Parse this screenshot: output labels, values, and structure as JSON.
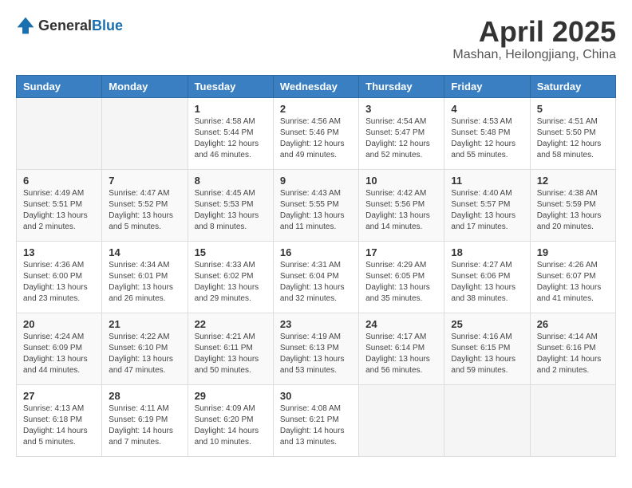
{
  "logo": {
    "general": "General",
    "blue": "Blue"
  },
  "header": {
    "month": "April 2025",
    "location": "Mashan, Heilongjiang, China"
  },
  "weekdays": [
    "Sunday",
    "Monday",
    "Tuesday",
    "Wednesday",
    "Thursday",
    "Friday",
    "Saturday"
  ],
  "weeks": [
    [
      {
        "day": "",
        "info": ""
      },
      {
        "day": "",
        "info": ""
      },
      {
        "day": "1",
        "info": "Sunrise: 4:58 AM\nSunset: 5:44 PM\nDaylight: 12 hours and 46 minutes."
      },
      {
        "day": "2",
        "info": "Sunrise: 4:56 AM\nSunset: 5:46 PM\nDaylight: 12 hours and 49 minutes."
      },
      {
        "day": "3",
        "info": "Sunrise: 4:54 AM\nSunset: 5:47 PM\nDaylight: 12 hours and 52 minutes."
      },
      {
        "day": "4",
        "info": "Sunrise: 4:53 AM\nSunset: 5:48 PM\nDaylight: 12 hours and 55 minutes."
      },
      {
        "day": "5",
        "info": "Sunrise: 4:51 AM\nSunset: 5:50 PM\nDaylight: 12 hours and 58 minutes."
      }
    ],
    [
      {
        "day": "6",
        "info": "Sunrise: 4:49 AM\nSunset: 5:51 PM\nDaylight: 13 hours and 2 minutes."
      },
      {
        "day": "7",
        "info": "Sunrise: 4:47 AM\nSunset: 5:52 PM\nDaylight: 13 hours and 5 minutes."
      },
      {
        "day": "8",
        "info": "Sunrise: 4:45 AM\nSunset: 5:53 PM\nDaylight: 13 hours and 8 minutes."
      },
      {
        "day": "9",
        "info": "Sunrise: 4:43 AM\nSunset: 5:55 PM\nDaylight: 13 hours and 11 minutes."
      },
      {
        "day": "10",
        "info": "Sunrise: 4:42 AM\nSunset: 5:56 PM\nDaylight: 13 hours and 14 minutes."
      },
      {
        "day": "11",
        "info": "Sunrise: 4:40 AM\nSunset: 5:57 PM\nDaylight: 13 hours and 17 minutes."
      },
      {
        "day": "12",
        "info": "Sunrise: 4:38 AM\nSunset: 5:59 PM\nDaylight: 13 hours and 20 minutes."
      }
    ],
    [
      {
        "day": "13",
        "info": "Sunrise: 4:36 AM\nSunset: 6:00 PM\nDaylight: 13 hours and 23 minutes."
      },
      {
        "day": "14",
        "info": "Sunrise: 4:34 AM\nSunset: 6:01 PM\nDaylight: 13 hours and 26 minutes."
      },
      {
        "day": "15",
        "info": "Sunrise: 4:33 AM\nSunset: 6:02 PM\nDaylight: 13 hours and 29 minutes."
      },
      {
        "day": "16",
        "info": "Sunrise: 4:31 AM\nSunset: 6:04 PM\nDaylight: 13 hours and 32 minutes."
      },
      {
        "day": "17",
        "info": "Sunrise: 4:29 AM\nSunset: 6:05 PM\nDaylight: 13 hours and 35 minutes."
      },
      {
        "day": "18",
        "info": "Sunrise: 4:27 AM\nSunset: 6:06 PM\nDaylight: 13 hours and 38 minutes."
      },
      {
        "day": "19",
        "info": "Sunrise: 4:26 AM\nSunset: 6:07 PM\nDaylight: 13 hours and 41 minutes."
      }
    ],
    [
      {
        "day": "20",
        "info": "Sunrise: 4:24 AM\nSunset: 6:09 PM\nDaylight: 13 hours and 44 minutes."
      },
      {
        "day": "21",
        "info": "Sunrise: 4:22 AM\nSunset: 6:10 PM\nDaylight: 13 hours and 47 minutes."
      },
      {
        "day": "22",
        "info": "Sunrise: 4:21 AM\nSunset: 6:11 PM\nDaylight: 13 hours and 50 minutes."
      },
      {
        "day": "23",
        "info": "Sunrise: 4:19 AM\nSunset: 6:13 PM\nDaylight: 13 hours and 53 minutes."
      },
      {
        "day": "24",
        "info": "Sunrise: 4:17 AM\nSunset: 6:14 PM\nDaylight: 13 hours and 56 minutes."
      },
      {
        "day": "25",
        "info": "Sunrise: 4:16 AM\nSunset: 6:15 PM\nDaylight: 13 hours and 59 minutes."
      },
      {
        "day": "26",
        "info": "Sunrise: 4:14 AM\nSunset: 6:16 PM\nDaylight: 14 hours and 2 minutes."
      }
    ],
    [
      {
        "day": "27",
        "info": "Sunrise: 4:13 AM\nSunset: 6:18 PM\nDaylight: 14 hours and 5 minutes."
      },
      {
        "day": "28",
        "info": "Sunrise: 4:11 AM\nSunset: 6:19 PM\nDaylight: 14 hours and 7 minutes."
      },
      {
        "day": "29",
        "info": "Sunrise: 4:09 AM\nSunset: 6:20 PM\nDaylight: 14 hours and 10 minutes."
      },
      {
        "day": "30",
        "info": "Sunrise: 4:08 AM\nSunset: 6:21 PM\nDaylight: 14 hours and 13 minutes."
      },
      {
        "day": "",
        "info": ""
      },
      {
        "day": "",
        "info": ""
      },
      {
        "day": "",
        "info": ""
      }
    ]
  ]
}
